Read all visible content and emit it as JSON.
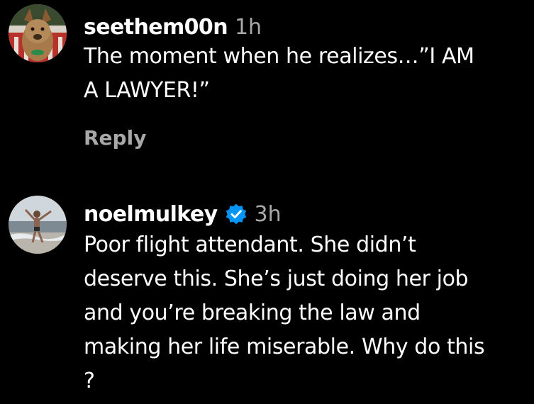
{
  "comments": [
    {
      "username": "seethem00n",
      "time": "1h",
      "verified": false,
      "avatar_icon": "dog-avatar",
      "text": "The moment when he realizes…”I AM\nA LAWYER!”",
      "reply_label": "Reply"
    },
    {
      "username": "noelmulkey",
      "time": "3h",
      "verified": true,
      "verified_icon": "verified-badge-icon",
      "avatar_icon": "beach-person-avatar",
      "text": "Poor flight attendant. She didn’t\ndeserve this. She’s just doing her job\nand you’re breaking the law and\nmaking her life miserable. Why do this\n?"
    }
  ],
  "colors": {
    "background": "#000000",
    "primary_text": "#ffffff",
    "secondary_text": "#a8a8a8",
    "verified_blue": "#0095f6"
  }
}
